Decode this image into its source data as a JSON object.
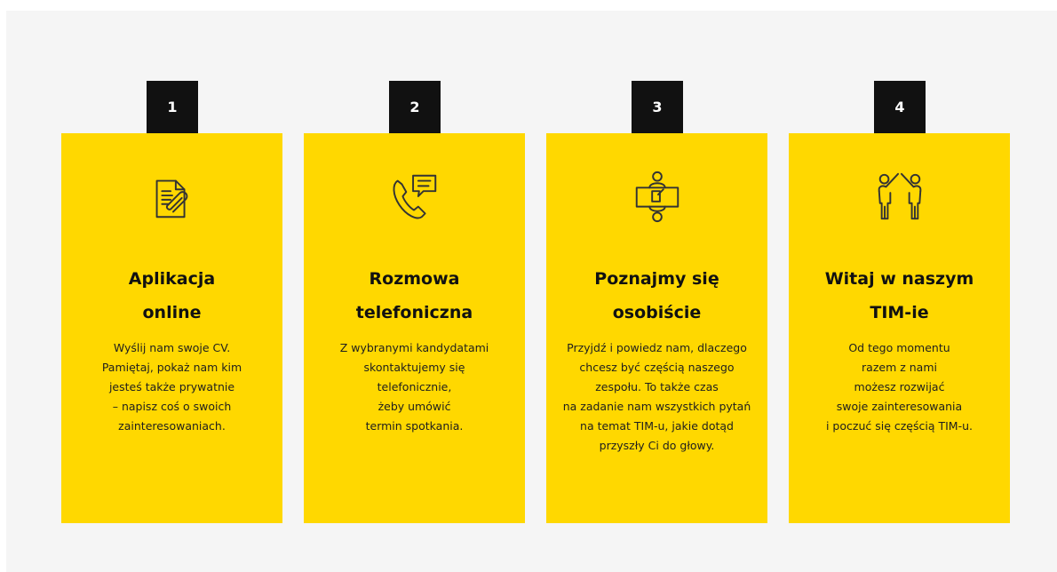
{
  "steps": [
    {
      "number": "1",
      "icon": "document-paperclip-icon",
      "title": [
        "Aplikacja",
        "online"
      ],
      "description": [
        "Wyślij nam swoje CV.",
        "Pamiętaj, pokaż nam kim",
        "jesteś także prywatnie",
        "– napisz coś o swoich",
        "zainteresowaniach."
      ]
    },
    {
      "number": "2",
      "icon": "phone-chat-icon",
      "title": [
        "Rozmowa",
        "telefoniczna"
      ],
      "description": [
        "Z wybranymi kandydatami",
        "skontaktujemy się",
        "telefonicznie,",
        "żeby umówić",
        "termin spotkania."
      ]
    },
    {
      "number": "3",
      "icon": "meeting-table-icon",
      "title": [
        "Poznajmy się",
        "osobiście"
      ],
      "description": [
        "Przyjdź i powiedz nam, dlaczego",
        "chcesz być częścią naszego",
        "zespołu. To także  czas",
        "na zadanie nam wszystkich pytań",
        "na temat TIM-u, jakie dotąd",
        "przyszły Ci do głowy."
      ]
    },
    {
      "number": "4",
      "icon": "high-five-people-icon",
      "title": [
        "Witaj w naszym",
        "TIM-ie"
      ],
      "description": [
        "Od tego momentu",
        "razem z nami",
        "możesz rozwijać",
        "swoje zainteresowania",
        "i poczuć się częścią TIM-u."
      ]
    }
  ],
  "colors": {
    "card": "#ffd800",
    "badge": "#111111",
    "background": "#f5f5f5"
  }
}
